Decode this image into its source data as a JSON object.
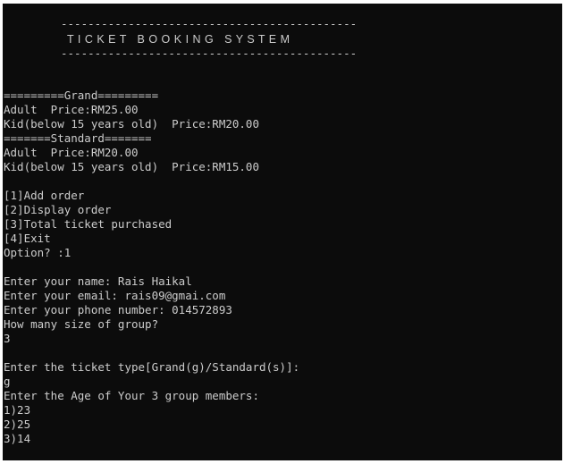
{
  "window": {
    "background": "#0c0c0c",
    "text_color": "#cccccc"
  },
  "console": {
    "header_rule_top": "--------------------------------------------",
    "header_title": "T I C K E T   B O O K I N G   S Y S T E M",
    "header_rule_bottom": "--------------------------------------------",
    "price_list": {
      "grand_header": "=========Grand=========",
      "grand_adult": "Adult  Price:RM25.00",
      "grand_kid": "Kid(below 15 years old)  Price:RM20.00",
      "standard_header": "=======Standard=======",
      "standard_adult": "Adult  Price:RM20.00",
      "standard_kid": "Kid(below 15 years old)  Price:RM15.00"
    },
    "menu": {
      "item_1": "[1]Add order",
      "item_2": "[2]Display order",
      "item_3": "[3]Total ticket purchased",
      "item_4": "[4]Exit",
      "option_prompt": "Option? :1"
    },
    "order_form": {
      "name_line": "Enter your name: Rais Haikal",
      "email_line": "Enter your email: rais09@gmai.com",
      "phone_line": "Enter your phone number: 014572893",
      "group_prompt": "How many size of group?",
      "group_answer": "3",
      "ticket_type_prompt": "Enter the ticket type[Grand(g)/Standard(s)]:",
      "ticket_type_answer": "g",
      "age_prompt": "Enter the Age of Your 3 group members:",
      "age_1": "1)23",
      "age_2": "2)25",
      "age_3": "3)14"
    }
  }
}
